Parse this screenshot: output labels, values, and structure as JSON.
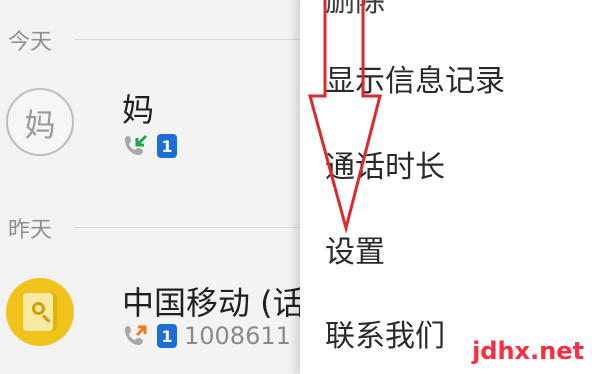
{
  "sections": [
    {
      "label": "今天"
    },
    {
      "label": "昨天"
    }
  ],
  "contacts": [
    {
      "avatar_text": "妈",
      "name": "妈",
      "sim": "1"
    },
    {
      "name": "中国移动 (话费",
      "sim": "1",
      "number": "1008611"
    }
  ],
  "menu": {
    "items": [
      {
        "label": "删除"
      },
      {
        "label": "显示信息记录"
      },
      {
        "label": "通话时长"
      },
      {
        "label": "设置"
      },
      {
        "label": "联系我们"
      }
    ]
  },
  "watermark": "jdhx.net",
  "colors": {
    "accent_blue": "#1d6ed6",
    "incoming_call_arrow": "#1aa74d",
    "outgoing_call_arrow": "#f07a1b",
    "annotation_red": "#e0272f"
  },
  "icons": {
    "incoming_call": "incoming-call-icon",
    "outgoing_call": "outgoing-call-icon"
  }
}
